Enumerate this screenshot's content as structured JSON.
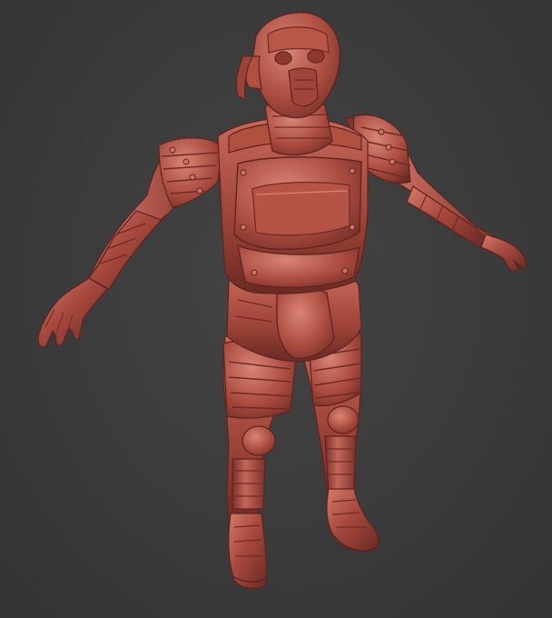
{
  "scene": {
    "subject": "armored-character-sculpt",
    "background_color": "#3a3a3a",
    "material_base_color": "#a8483d",
    "material_highlight_color": "#d47a6a",
    "material_shadow_color": "#5e2420"
  }
}
